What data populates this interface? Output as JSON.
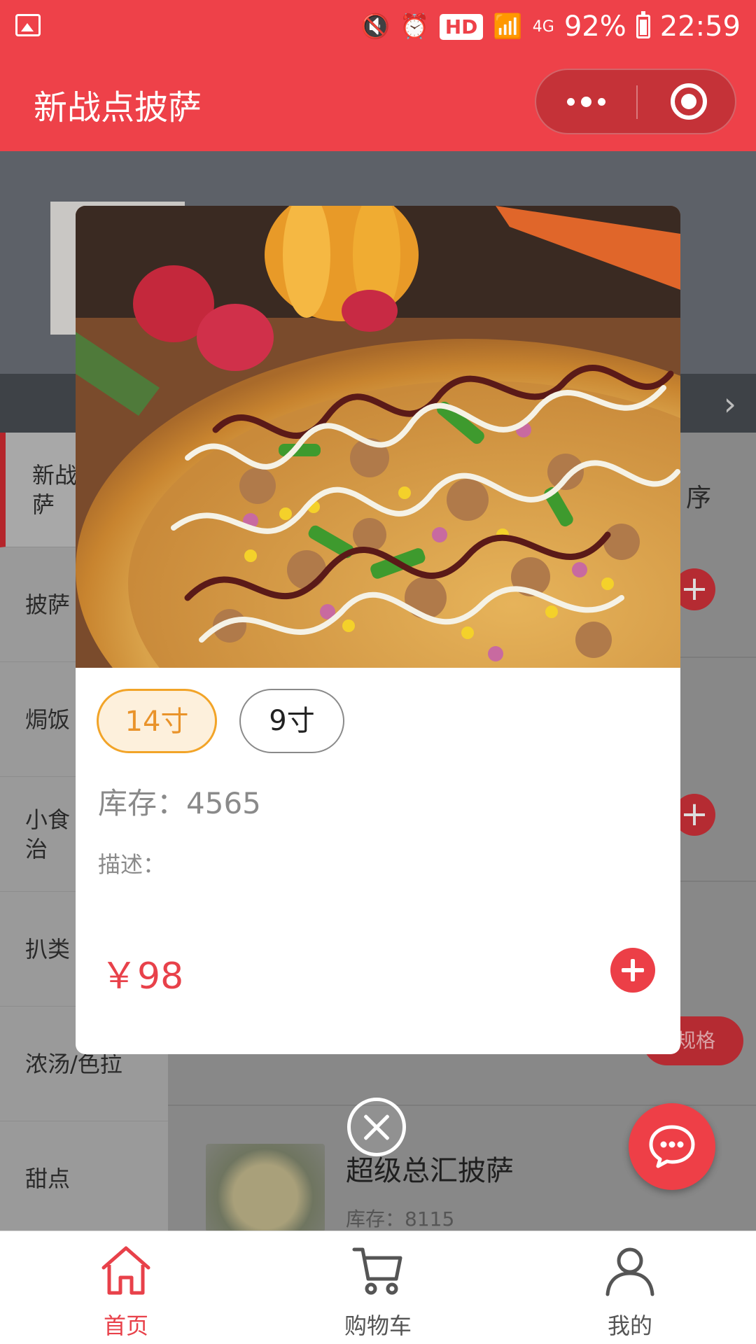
{
  "status_bar": {
    "hd_label": "HD",
    "network_label": "4G",
    "battery_percent": "92%",
    "time": "22:59"
  },
  "header": {
    "title": "新战点披萨"
  },
  "sidebar": {
    "items": [
      {
        "label": "新战\n萨"
      },
      {
        "label": "披萨"
      },
      {
        "label": "焗饭"
      },
      {
        "label": "小食\n治"
      },
      {
        "label": "扒类"
      },
      {
        "label": "浓汤/色拉"
      },
      {
        "label": "甜点"
      }
    ]
  },
  "background": {
    "partial_text_1": "序",
    "partial_spec_button": "规格",
    "item_name": "超级总汇披萨",
    "item_stock": "库存：8115"
  },
  "modal": {
    "sizes": [
      {
        "label": "14寸",
        "selected": true
      },
      {
        "label": "9寸",
        "selected": false
      }
    ],
    "stock_text": "库存：4565",
    "desc_text": "描述：",
    "price_text": "￥98"
  },
  "tab_bar": {
    "tabs": [
      {
        "label": "首页",
        "icon": "home-icon",
        "active": true
      },
      {
        "label": "购物车",
        "icon": "cart-icon",
        "active": false
      },
      {
        "label": "我的",
        "icon": "user-icon",
        "active": false
      }
    ]
  },
  "colors": {
    "brand": "#ee4149",
    "selected_size": "#f2a428",
    "price": "#e8414a"
  }
}
